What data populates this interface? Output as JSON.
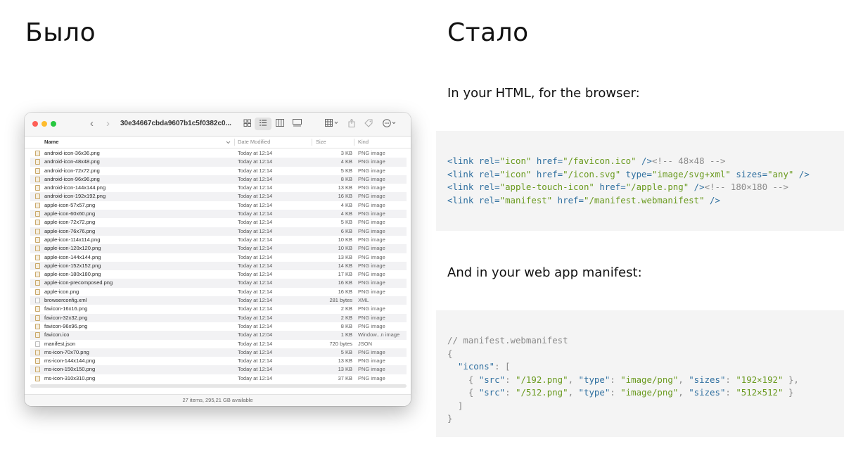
{
  "slide": {
    "before_heading": "Было",
    "after_heading": "Стало",
    "html_caption": "In your HTML, for the browser:",
    "manifest_caption": "And in your web app manifest:"
  },
  "finder": {
    "window_title": "30e34667cbda9607b1c5f0382c0...",
    "icons": [
      "chevron-left-icon",
      "chevron-right-icon",
      "grid-view-icon",
      "list-view-icon",
      "column-view-icon",
      "gallery-view-icon",
      "group-icon",
      "share-icon",
      "tag-icon",
      "more-icon",
      "search-icon"
    ],
    "columns": {
      "name": "Name",
      "date": "Date Modified",
      "size": "Size",
      "kind": "Kind"
    },
    "files": [
      {
        "name": "android-icon-36x36.png",
        "date": "Today at 12:14",
        "size": "3 KB",
        "kind": "PNG image"
      },
      {
        "name": "android-icon-48x48.png",
        "date": "Today at 12:14",
        "size": "4 KB",
        "kind": "PNG image"
      },
      {
        "name": "android-icon-72x72.png",
        "date": "Today at 12:14",
        "size": "5 KB",
        "kind": "PNG image"
      },
      {
        "name": "android-icon-96x96.png",
        "date": "Today at 12:14",
        "size": "8 KB",
        "kind": "PNG image"
      },
      {
        "name": "android-icon-144x144.png",
        "date": "Today at 12:14",
        "size": "13 KB",
        "kind": "PNG image"
      },
      {
        "name": "android-icon-192x192.png",
        "date": "Today at 12:14",
        "size": "16 KB",
        "kind": "PNG image"
      },
      {
        "name": "apple-icon-57x57.png",
        "date": "Today at 12:14",
        "size": "4 KB",
        "kind": "PNG image"
      },
      {
        "name": "apple-icon-60x60.png",
        "date": "Today at 12:14",
        "size": "4 KB",
        "kind": "PNG image"
      },
      {
        "name": "apple-icon-72x72.png",
        "date": "Today at 12:14",
        "size": "5 KB",
        "kind": "PNG image"
      },
      {
        "name": "apple-icon-76x76.png",
        "date": "Today at 12:14",
        "size": "6 KB",
        "kind": "PNG image"
      },
      {
        "name": "apple-icon-114x114.png",
        "date": "Today at 12:14",
        "size": "10 KB",
        "kind": "PNG image"
      },
      {
        "name": "apple-icon-120x120.png",
        "date": "Today at 12:14",
        "size": "10 KB",
        "kind": "PNG image"
      },
      {
        "name": "apple-icon-144x144.png",
        "date": "Today at 12:14",
        "size": "13 KB",
        "kind": "PNG image"
      },
      {
        "name": "apple-icon-152x152.png",
        "date": "Today at 12:14",
        "size": "14 KB",
        "kind": "PNG image"
      },
      {
        "name": "apple-icon-180x180.png",
        "date": "Today at 12:14",
        "size": "17 KB",
        "kind": "PNG image"
      },
      {
        "name": "apple-icon-precomposed.png",
        "date": "Today at 12:14",
        "size": "16 KB",
        "kind": "PNG image"
      },
      {
        "name": "apple-icon.png",
        "date": "Today at 12:14",
        "size": "16 KB",
        "kind": "PNG image"
      },
      {
        "name": "browserconfig.xml",
        "date": "Today at 12:14",
        "size": "281 bytes",
        "kind": "XML"
      },
      {
        "name": "favicon-16x16.png",
        "date": "Today at 12:14",
        "size": "2 KB",
        "kind": "PNG image"
      },
      {
        "name": "favicon-32x32.png",
        "date": "Today at 12:14",
        "size": "2 KB",
        "kind": "PNG image"
      },
      {
        "name": "favicon-96x96.png",
        "date": "Today at 12:14",
        "size": "8 KB",
        "kind": "PNG image"
      },
      {
        "name": "favicon.ico",
        "date": "Today at 12:04",
        "size": "1 KB",
        "kind": "Window...n image"
      },
      {
        "name": "manifest.json",
        "date": "Today at 12:14",
        "size": "720 bytes",
        "kind": "JSON"
      },
      {
        "name": "ms-icon-70x70.png",
        "date": "Today at 12:14",
        "size": "5 KB",
        "kind": "PNG image"
      },
      {
        "name": "ms-icon-144x144.png",
        "date": "Today at 12:14",
        "size": "13 KB",
        "kind": "PNG image"
      },
      {
        "name": "ms-icon-150x150.png",
        "date": "Today at 12:14",
        "size": "13 KB",
        "kind": "PNG image"
      },
      {
        "name": "ms-icon-310x310.png",
        "date": "Today at 12:14",
        "size": "37 KB",
        "kind": "PNG image"
      }
    ],
    "status": "27 items, 295,21 GB available"
  },
  "html_code": {
    "lines": [
      [
        [
          "tag",
          "<link "
        ],
        [
          "attr",
          "rel="
        ],
        [
          "str",
          "\"icon\""
        ],
        [
          "attr",
          " href="
        ],
        [
          "str",
          "\"/favicon.ico\""
        ],
        [
          "tag",
          " />"
        ],
        [
          "cmt",
          "<!-- 48×48 -->"
        ]
      ],
      [
        [
          "tag",
          "<link "
        ],
        [
          "attr",
          "rel="
        ],
        [
          "str",
          "\"icon\""
        ],
        [
          "attr",
          " href="
        ],
        [
          "str",
          "\"/icon.svg\""
        ],
        [
          "attr",
          " type="
        ],
        [
          "str",
          "\"image/svg+xml\""
        ],
        [
          "attr",
          " sizes="
        ],
        [
          "str",
          "\"any\""
        ],
        [
          "tag",
          " />"
        ]
      ],
      [
        [
          "tag",
          "<link "
        ],
        [
          "attr",
          "rel="
        ],
        [
          "str",
          "\"apple-touch-icon\""
        ],
        [
          "attr",
          " href="
        ],
        [
          "str",
          "\"/apple.png\""
        ],
        [
          "tag",
          " />"
        ],
        [
          "cmt",
          "<!-- 180×180 -->"
        ]
      ],
      [
        [
          "tag",
          "<link "
        ],
        [
          "attr",
          "rel="
        ],
        [
          "str",
          "\"manifest\""
        ],
        [
          "attr",
          " href="
        ],
        [
          "str",
          "\"/manifest.webmanifest\""
        ],
        [
          "tag",
          " />"
        ]
      ]
    ]
  },
  "manifest_code": {
    "lines": [
      [
        [
          "cmt",
          "// manifest.webmanifest"
        ]
      ],
      [
        [
          "punct",
          "{"
        ]
      ],
      [
        [
          "punct",
          "  "
        ],
        [
          "key",
          "\"icons\""
        ],
        [
          "punct",
          ": ["
        ]
      ],
      [
        [
          "punct",
          "    { "
        ],
        [
          "key",
          "\"src\""
        ],
        [
          "punct",
          ": "
        ],
        [
          "str",
          "\"/192.png\""
        ],
        [
          "punct",
          ", "
        ],
        [
          "key",
          "\"type\""
        ],
        [
          "punct",
          ": "
        ],
        [
          "str",
          "\"image/png\""
        ],
        [
          "punct",
          ", "
        ],
        [
          "key",
          "\"sizes\""
        ],
        [
          "punct",
          ": "
        ],
        [
          "str",
          "\"192×192\""
        ],
        [
          "punct",
          " },"
        ]
      ],
      [
        [
          "punct",
          "    { "
        ],
        [
          "key",
          "\"src\""
        ],
        [
          "punct",
          ": "
        ],
        [
          "str",
          "\"/512.png\""
        ],
        [
          "punct",
          ", "
        ],
        [
          "key",
          "\"type\""
        ],
        [
          "punct",
          ": "
        ],
        [
          "str",
          "\"image/png\""
        ],
        [
          "punct",
          ", "
        ],
        [
          "key",
          "\"sizes\""
        ],
        [
          "punct",
          ": "
        ],
        [
          "str",
          "\"512×512\""
        ],
        [
          "punct",
          " }"
        ]
      ],
      [
        [
          "punct",
          "  ]"
        ]
      ],
      [
        [
          "punct",
          "}"
        ]
      ]
    ]
  }
}
